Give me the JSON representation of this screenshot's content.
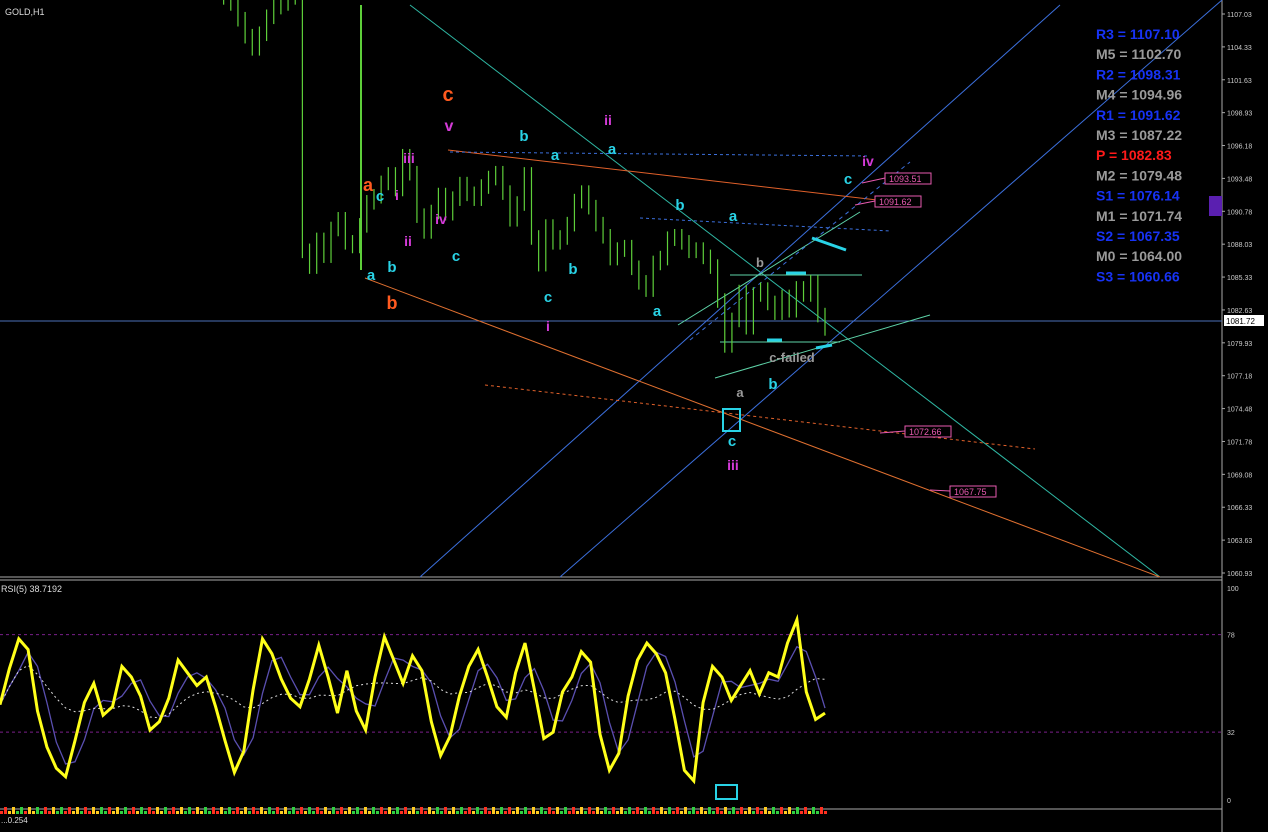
{
  "window": {
    "symbol_title": "GOLD,H1",
    "rsi_title": "RSI(5) 38.7192",
    "bottom_indicator_label": "...0.254",
    "current_price_label": "1081.72"
  },
  "colors": {
    "background": "#000000",
    "candles": "#5ecf3a",
    "rsi_line": "#ffff1a",
    "ma_line": "#5a4fb0",
    "pivot_r": "#1733f5",
    "pivot_m": "#9a9a9a",
    "pivot_p": "#ff1a1a",
    "cyan": "#29d3e6",
    "magenta": "#d43bd8",
    "orange": "#ff5a1f",
    "dark_blue_box": "#5a1fb0"
  },
  "price_axis": {
    "ticks": [
      "1107.03",
      "1104.33",
      "1101.63",
      "1098.93",
      "1096.18",
      "1093.48",
      "1090.78",
      "1088.03",
      "1085.33",
      "1082.63",
      "1079.93",
      "1077.18",
      "1074.48",
      "1071.78",
      "1069.08",
      "1066.33",
      "1063.63",
      "1060.93"
    ]
  },
  "rsi_axis": {
    "ticks": [
      "100",
      "78",
      "32",
      "0"
    ]
  },
  "pivots": [
    {
      "label": "R3 = 1107.10",
      "kind": "r"
    },
    {
      "label": "M5 = 1102.70",
      "kind": "m"
    },
    {
      "label": "R2 = 1098.31",
      "kind": "r"
    },
    {
      "label": "M4 = 1094.96",
      "kind": "m"
    },
    {
      "label": "R1 = 1091.62",
      "kind": "r"
    },
    {
      "label": "M3 = 1087.22",
      "kind": "m"
    },
    {
      "label": "P  = 1082.83",
      "kind": "p"
    },
    {
      "label": "M2 = 1079.48",
      "kind": "m"
    },
    {
      "label": "S1 = 1076.14",
      "kind": "r"
    },
    {
      "label": "M1 = 1071.74",
      "kind": "m"
    },
    {
      "label": "S2 = 1067.35",
      "kind": "r"
    },
    {
      "label": "M0 = 1064.00",
      "kind": "m"
    },
    {
      "label": "S3 = 1060.66",
      "kind": "r"
    }
  ],
  "price_boxes": [
    "1093.51",
    "1091.62",
    "1072.66",
    "1067.75"
  ],
  "wave_labels": [
    {
      "text": "c",
      "color": "orange"
    },
    {
      "text": "a",
      "color": "orange"
    },
    {
      "text": "b",
      "color": "orange"
    },
    {
      "text": "v",
      "color": "magenta"
    },
    {
      "text": "iii",
      "color": "magenta"
    },
    {
      "text": "i",
      "color": "magenta"
    },
    {
      "text": "ii",
      "color": "magenta"
    },
    {
      "text": "iv",
      "color": "magenta"
    },
    {
      "text": "ii",
      "color": "magenta"
    },
    {
      "text": "i",
      "color": "magenta"
    },
    {
      "text": "iii",
      "color": "magenta"
    },
    {
      "text": "iv",
      "color": "magenta"
    },
    {
      "text": "b",
      "color": "cyan"
    },
    {
      "text": "a",
      "color": "cyan"
    },
    {
      "text": "c",
      "color": "cyan"
    },
    {
      "text": "b",
      "color": "cyan"
    },
    {
      "text": "a",
      "color": "cyan"
    },
    {
      "text": "c",
      "color": "cyan"
    },
    {
      "text": "b",
      "color": "cyan"
    },
    {
      "text": "c",
      "color": "cyan"
    },
    {
      "text": "a",
      "color": "cyan"
    },
    {
      "text": "b",
      "color": "cyan"
    },
    {
      "text": "a",
      "color": "cyan"
    },
    {
      "text": "a",
      "color": "cyan"
    },
    {
      "text": "c",
      "color": "cyan"
    },
    {
      "text": "b",
      "color": "cyan"
    },
    {
      "text": "c",
      "color": "cyan"
    },
    {
      "text": "b",
      "color": "grey"
    },
    {
      "text": "a",
      "color": "grey"
    },
    {
      "text": "c-failed",
      "color": "grey"
    }
  ],
  "chart_data": {
    "type": "line",
    "title": "GOLD,H1",
    "ylim": [
      1060.93,
      1107.03
    ],
    "price_close": [
      1110.5,
      1110.2,
      1109.8,
      1109.1,
      1108.4,
      1107.9,
      1106.6,
      1105.2,
      1104.2,
      1105.4,
      1106.8,
      1107.6,
      1107.9,
      1108.4,
      1108.5,
      1087.5,
      1086.2,
      1088.4,
      1087.1,
      1089.3,
      1090.1,
      1088.2,
      1087.9,
      1089.6,
      1091.5,
      1092.0,
      1093.1,
      1093.8,
      1092.6,
      1095.3,
      1093.9,
      1090.4,
      1089.1,
      1090.7,
      1092.1,
      1090.6,
      1091.8,
      1093.0,
      1092.2,
      1091.8,
      1092.8,
      1093.5,
      1093.9,
      1092.3,
      1090.1,
      1091.4,
      1093.8,
      1088.6,
      1086.4,
      1089.5,
      1088.2,
      1088.6,
      1089.7,
      1091.6,
      1092.3,
      1091.1,
      1089.7,
      1088.7,
      1086.9,
      1087.6,
      1087.8,
      1086.1,
      1084.9,
      1084.3,
      1086.5,
      1086.9,
      1088.5,
      1088.7,
      1088.2,
      1087.5,
      1087.6,
      1087.0,
      1086.2,
      1083.4,
      1079.7,
      1081.8,
      1084.1,
      1081.2,
      1083.9,
      1084.3,
      1083.2,
      1082.4,
      1083.7,
      1082.6,
      1084.4,
      1083.9,
      1084.9,
      1082.2,
      1081.1
    ],
    "rsi": {
      "name": "RSI(5)",
      "last_value": 38.7192,
      "levels": [
        78,
        32
      ],
      "ylim": [
        0,
        100
      ],
      "values": [
        45,
        62,
        76,
        71,
        42,
        25,
        15,
        11,
        28,
        46,
        55,
        40,
        44,
        63,
        58,
        49,
        33,
        37,
        48,
        66,
        60,
        54,
        58,
        44,
        28,
        13,
        23,
        52,
        76,
        69,
        57,
        48,
        44,
        57,
        73,
        58,
        41,
        61,
        42,
        33,
        58,
        77,
        66,
        55,
        68,
        61,
        37,
        21,
        30,
        49,
        63,
        71,
        58,
        44,
        39,
        60,
        74,
        52,
        29,
        32,
        51,
        58,
        70,
        65,
        31,
        14,
        22,
        49,
        66,
        74,
        69,
        60,
        38,
        14,
        9,
        46,
        63,
        58,
        47,
        54,
        61,
        50,
        60,
        58,
        74,
        85,
        51,
        38,
        41
      ]
    }
  }
}
